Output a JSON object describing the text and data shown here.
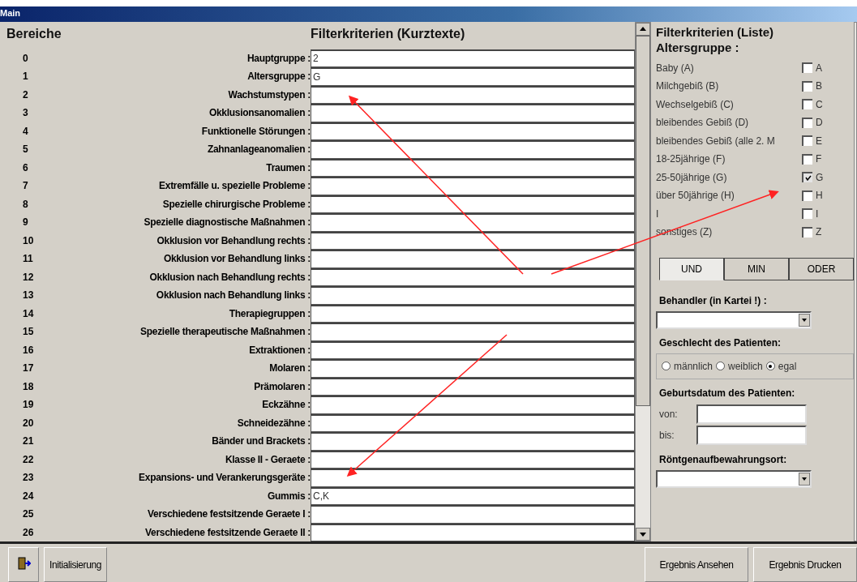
{
  "window": {
    "title": "Main"
  },
  "left": {
    "header_areas": "Bereiche",
    "header_criteria": "Filterkriterien (Kurztexte)",
    "rows": [
      {
        "number": "0",
        "label": "Hauptgruppe :",
        "value": "2"
      },
      {
        "number": "1",
        "label": "Altersgruppe :",
        "value": "G"
      },
      {
        "number": "2",
        "label": "Wachstumstypen :",
        "value": ""
      },
      {
        "number": "3",
        "label": "Okklusionsanomalien :",
        "value": ""
      },
      {
        "number": "4",
        "label": "Funktionelle Störungen :",
        "value": ""
      },
      {
        "number": "5",
        "label": "Zahnanlageanomalien :",
        "value": ""
      },
      {
        "number": "6",
        "label": "Traumen :",
        "value": ""
      },
      {
        "number": "7",
        "label": "Extremfälle u. spezielle Probleme :",
        "value": ""
      },
      {
        "number": "8",
        "label": "Spezielle chirurgische Probleme :",
        "value": ""
      },
      {
        "number": "9",
        "label": "Spezielle diagnostische Maßnahmen :",
        "value": ""
      },
      {
        "number": "10",
        "label": "Okklusion vor Behandlung rechts :",
        "value": ""
      },
      {
        "number": "11",
        "label": "Okklusion vor Behandlung links :",
        "value": ""
      },
      {
        "number": "12",
        "label": "Okklusion nach Behandlung rechts :",
        "value": ""
      },
      {
        "number": "13",
        "label": "Okklusion nach Behandlung links :",
        "value": ""
      },
      {
        "number": "14",
        "label": "Therapiegruppen :",
        "value": ""
      },
      {
        "number": "15",
        "label": "Spezielle therapeutische Maßnahmen :",
        "value": ""
      },
      {
        "number": "16",
        "label": "Extraktionen :",
        "value": ""
      },
      {
        "number": "17",
        "label": "Molaren :",
        "value": ""
      },
      {
        "number": "18",
        "label": "Prämolaren :",
        "value": ""
      },
      {
        "number": "19",
        "label": "Eckzähne :",
        "value": ""
      },
      {
        "number": "20",
        "label": "Schneidezähne :",
        "value": ""
      },
      {
        "number": "21",
        "label": "Bänder und Brackets :",
        "value": ""
      },
      {
        "number": "22",
        "label": "Klasse II - Geraete :",
        "value": ""
      },
      {
        "number": "23",
        "label": "Expansions- und Verankerungsgeräte :",
        "value": ""
      },
      {
        "number": "24",
        "label": "Gummis :",
        "value": "C,K"
      },
      {
        "number": "25",
        "label": "Verschiedene festsitzende Geraete I :",
        "value": ""
      },
      {
        "number": "26",
        "label": "Verschiedene festsitzende Geraete II :",
        "value": ""
      }
    ]
  },
  "right": {
    "title": "Filterkriterien (Liste)",
    "subtitle": "Altersgruppe :",
    "items": [
      {
        "label": "Baby (A)",
        "letter": "A",
        "checked": false
      },
      {
        "label": "Milchgebiß (B)",
        "letter": "B",
        "checked": false
      },
      {
        "label": "Wechselgebiß (C)",
        "letter": "C",
        "checked": false
      },
      {
        "label": "bleibendes Gebiß (D)",
        "letter": "D",
        "checked": false
      },
      {
        "label": "bleibendes Gebiß (alle 2. M",
        "letter": "E",
        "checked": false
      },
      {
        "label": "18-25jährige (F)",
        "letter": "F",
        "checked": false
      },
      {
        "label": "25-50jährige (G)",
        "letter": "G",
        "checked": true
      },
      {
        "label": "über 50jährige (H)",
        "letter": "H",
        "checked": false
      },
      {
        "label": "I",
        "letter": "I",
        "checked": false
      },
      {
        "label": "sonstiges (Z)",
        "letter": "Z",
        "checked": false
      }
    ],
    "logic": [
      {
        "label": "UND",
        "selected": true
      },
      {
        "label": "MIN",
        "selected": false
      },
      {
        "label": "ODER",
        "selected": false
      }
    ],
    "behandler_label": "Behandler (in Kartei !) :",
    "gender_label": "Geschlecht des Patienten:",
    "gender_options": [
      {
        "label": "männlich",
        "selected": false
      },
      {
        "label": "weiblich",
        "selected": false
      },
      {
        "label": "egal",
        "selected": true
      }
    ],
    "birth_label": "Geburtsdatum des Patienten:",
    "from_label": "von:",
    "to_label": "bis:",
    "xray_label": "Röntgenaufbewahrungsort:"
  },
  "footer": {
    "init_button": "Initialisierung",
    "view_button": "Ergebnis Ansehen",
    "print_button": "Ergebnis Drucken"
  }
}
